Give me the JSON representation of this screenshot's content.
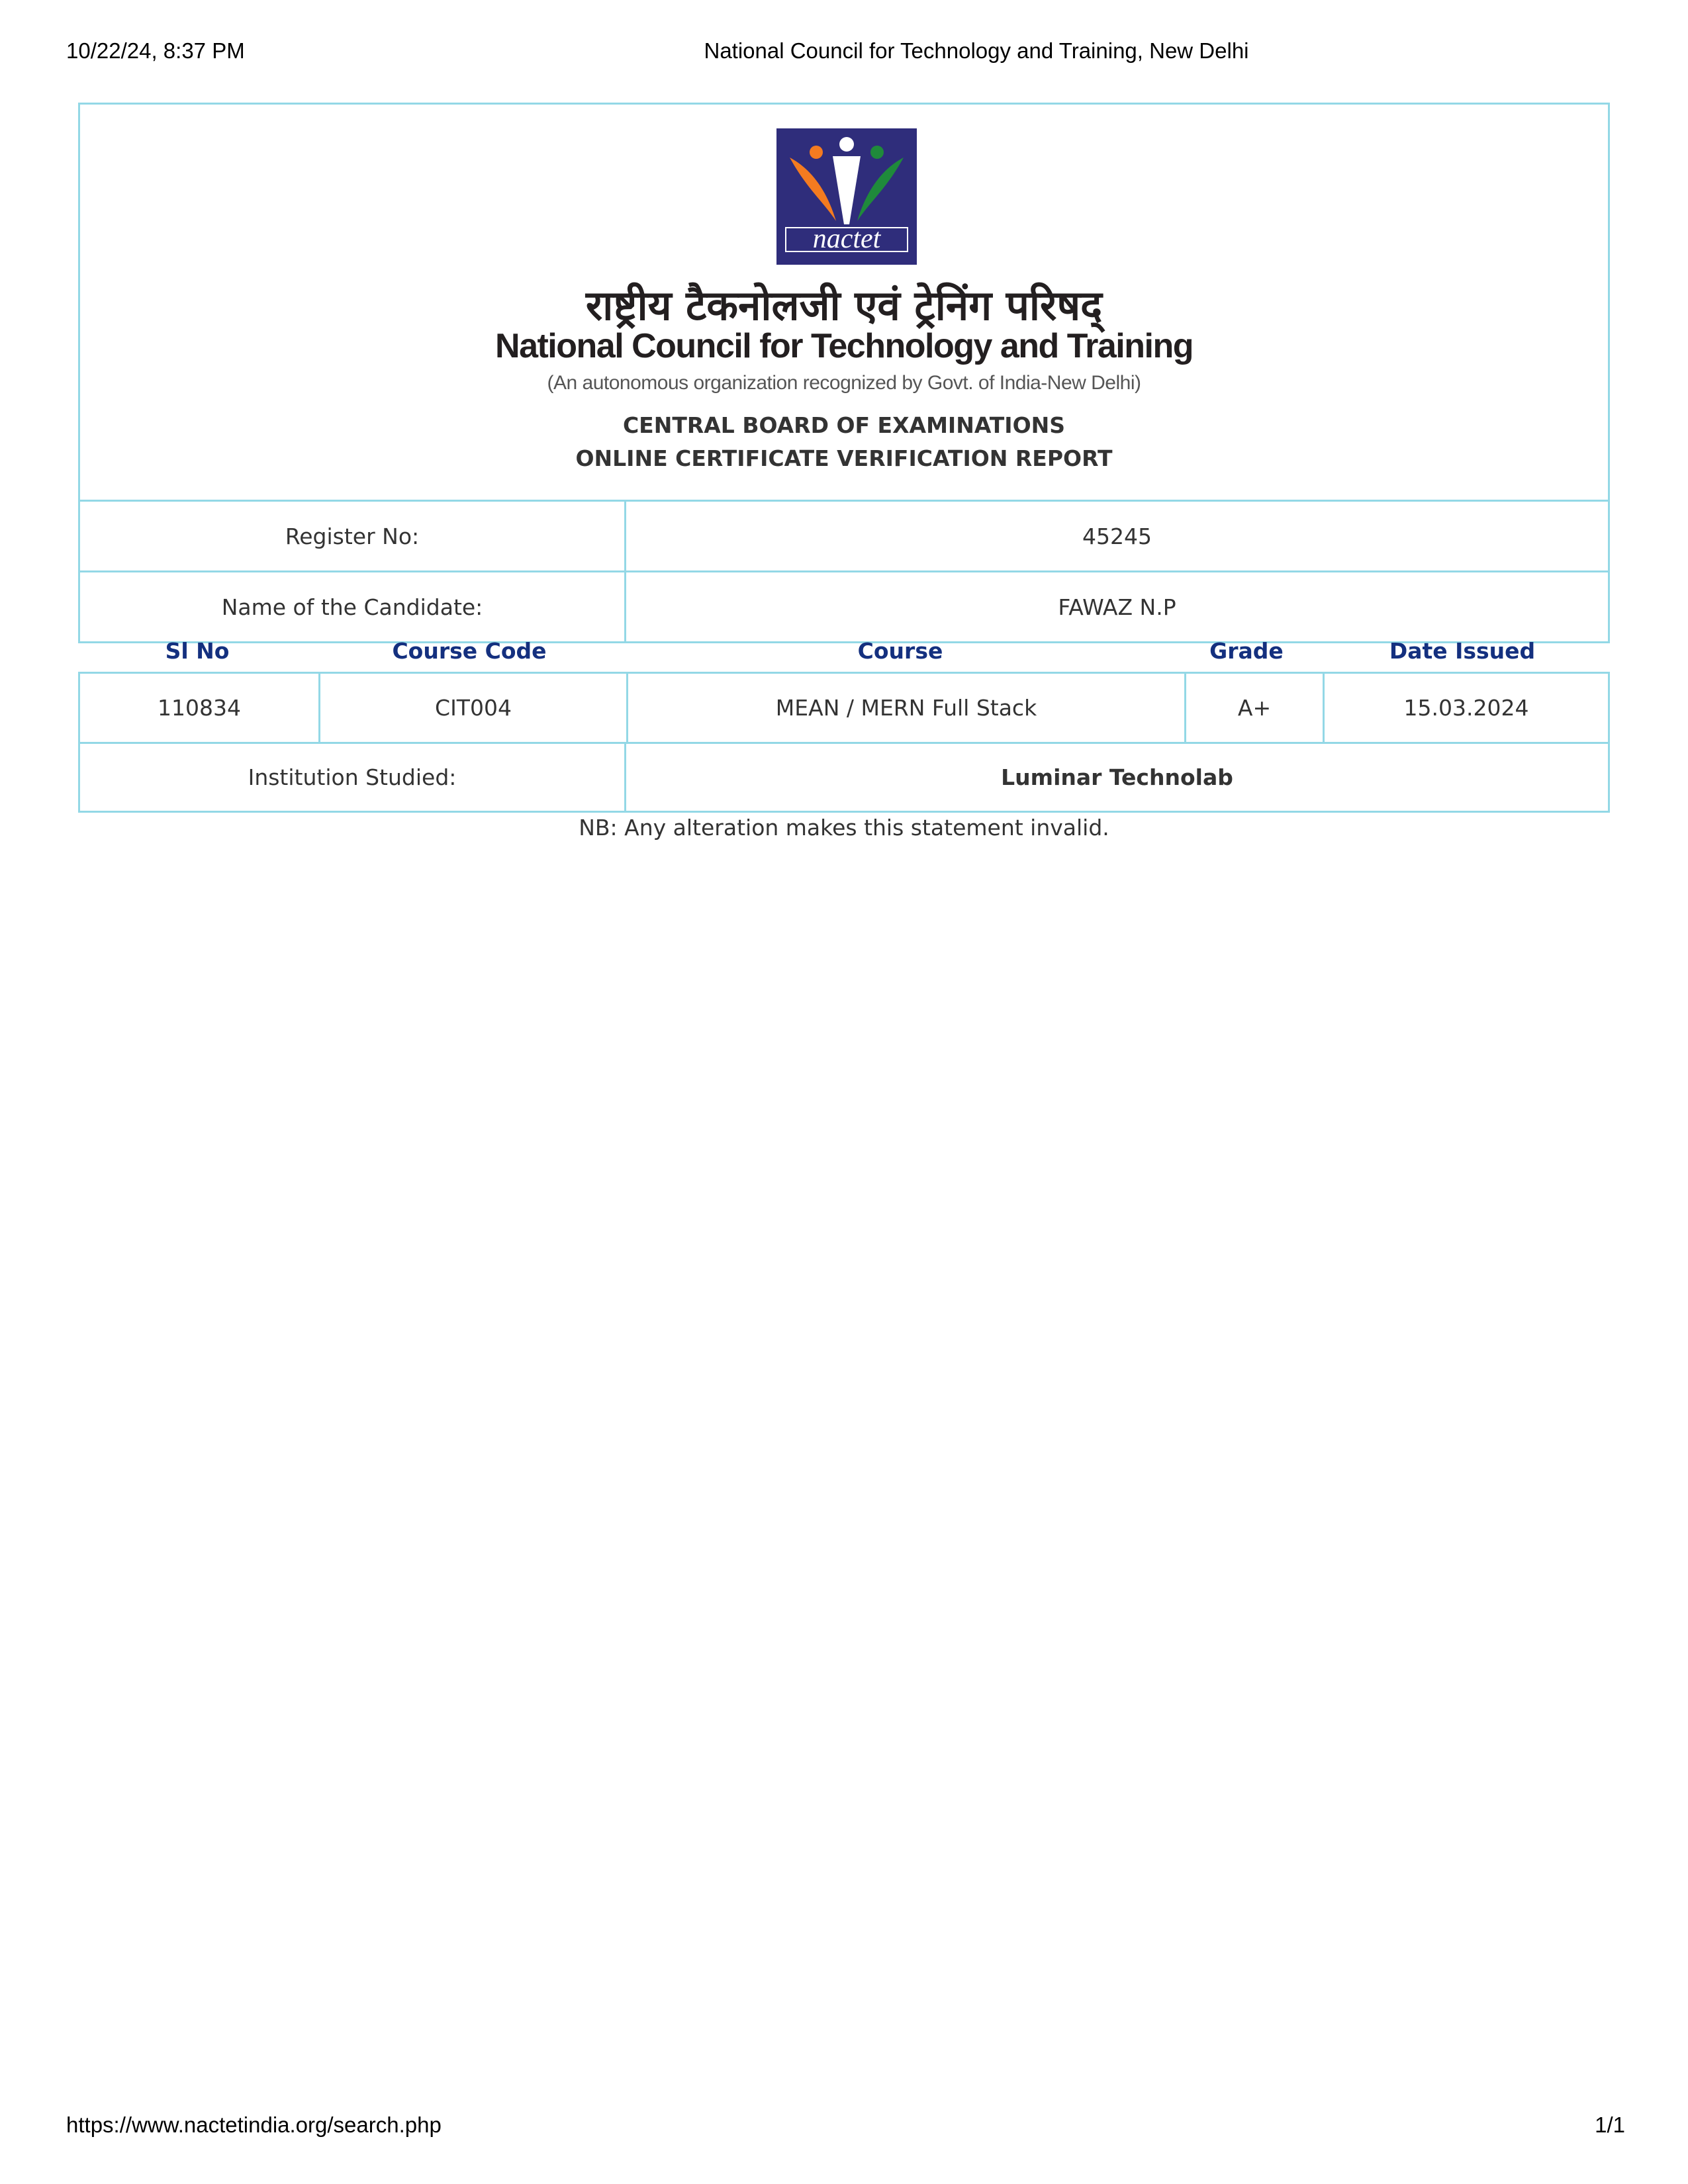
{
  "print_header": {
    "datetime": "10/22/24, 8:37 PM",
    "page_title": "National Council for Technology and Training, New Delhi"
  },
  "print_footer": {
    "url": "https://www.nactetindia.org/search.php",
    "page": "1/1"
  },
  "header": {
    "logo_text": "nactet",
    "hindi_name": "राष्ट्रीय टैकनोलजी एवं ट्रेनिंग परिषद्",
    "org_name": "National Council for Technology and Training",
    "org_subtitle": "(An autonomous organization recognized by Govt. of India-New Delhi)",
    "board_line1": "CENTRAL BOARD OF EXAMINATIONS",
    "board_line2": "ONLINE CERTIFICATE VERIFICATION REPORT"
  },
  "candidate": {
    "register_label": "Register No:",
    "register_value": "45245",
    "name_label": "Name of the Candidate:",
    "name_value": "FAWAZ N.P"
  },
  "course_table": {
    "columns": [
      "Sl No",
      "Course Code",
      "Course",
      "Grade",
      "Date Issued"
    ],
    "rows": [
      [
        "110834",
        "CIT004",
        "MEAN / MERN Full Stack",
        "A+",
        "15.03.2024"
      ]
    ]
  },
  "institution": {
    "label": "Institution Studied:",
    "value": "Luminar Technolab"
  },
  "note": "NB: Any alteration makes this statement invalid.",
  "colors": {
    "border": "#93d8e6",
    "column_header": "#14307f",
    "logo_bg": "#2f2d7b",
    "logo_orange": "#f47b20",
    "logo_green": "#1f8a3b"
  }
}
